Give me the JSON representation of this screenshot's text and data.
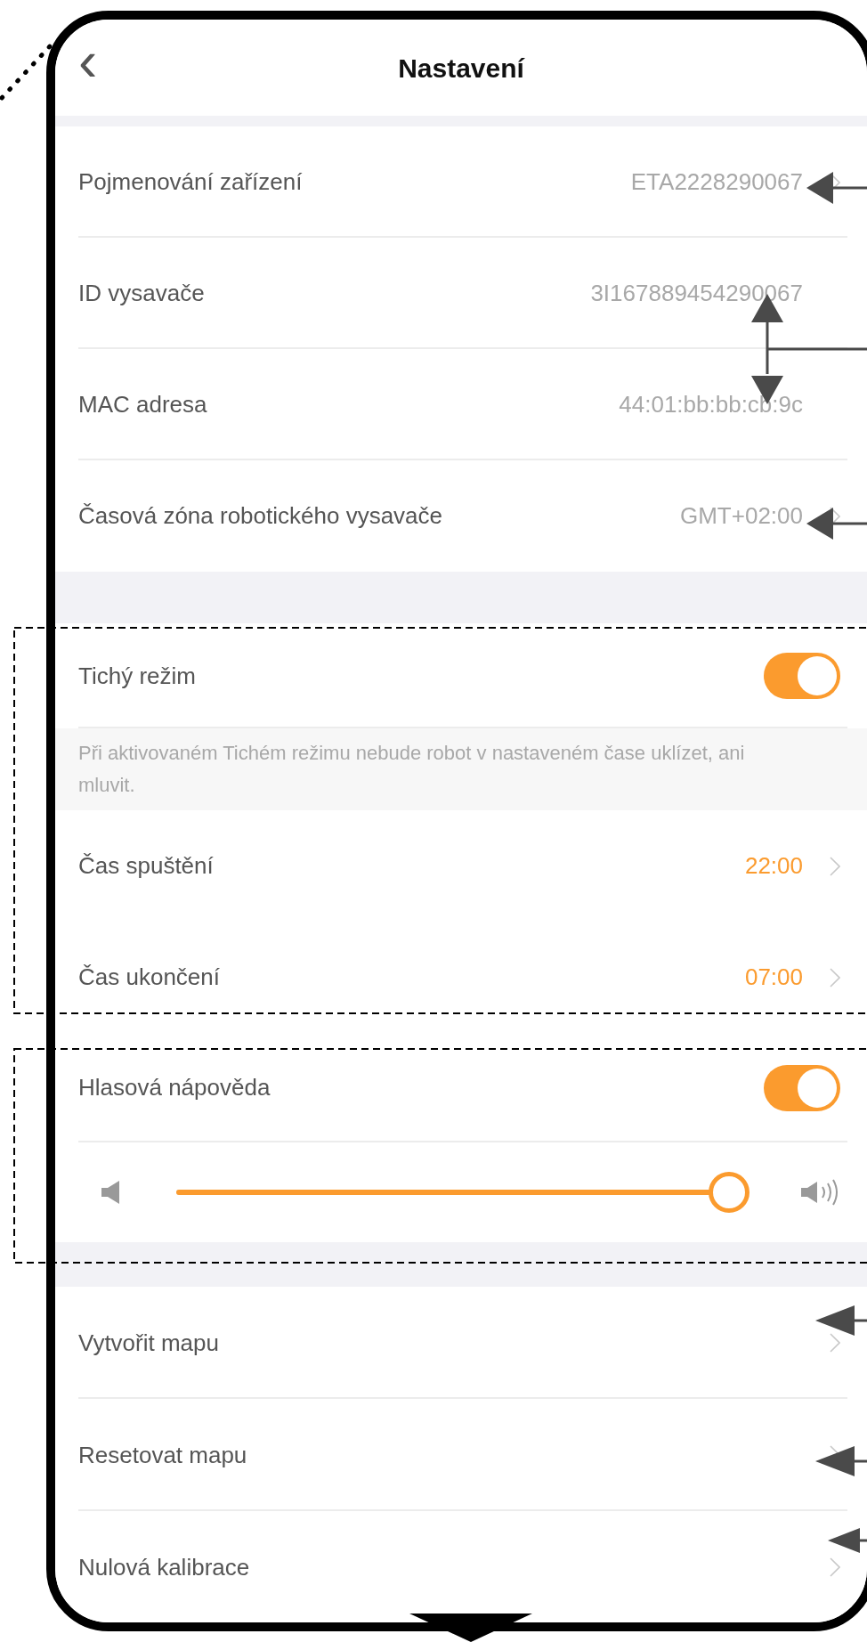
{
  "header": {
    "back": "‹",
    "title": "Nastavení"
  },
  "device_rows": [
    {
      "label": "Pojmenování zařízení",
      "value": "ETA2228290067",
      "chevron": true
    },
    {
      "label": "ID vysavače",
      "value": "3I167889454290067",
      "chevron": false
    },
    {
      "label": "MAC adresa",
      "value": "44:01:bb:bb:cb:9c",
      "chevron": false
    },
    {
      "label": "Časová zóna robotického vysavače",
      "value": "GMT+02:00",
      "chevron": true
    }
  ],
  "quiet_mode": {
    "label": "Tichý režim",
    "on": true,
    "note": "Při aktivovaném Tichém režimu nebude robot v nastaveném čase uklízet, ani mluvit.",
    "times": [
      {
        "label": "Čas spuštění",
        "value": "22:00"
      },
      {
        "label": "Čas ukončení",
        "value": "07:00"
      }
    ]
  },
  "voice_prompt": {
    "label": "Hlasová nápověda",
    "on": true,
    "volume": {
      "level": 0.97
    }
  },
  "action_rows": [
    {
      "label": "Vytvořit mapu"
    },
    {
      "label": "Resetovat mapu"
    },
    {
      "label": "Nulová kalibrace"
    }
  ]
}
